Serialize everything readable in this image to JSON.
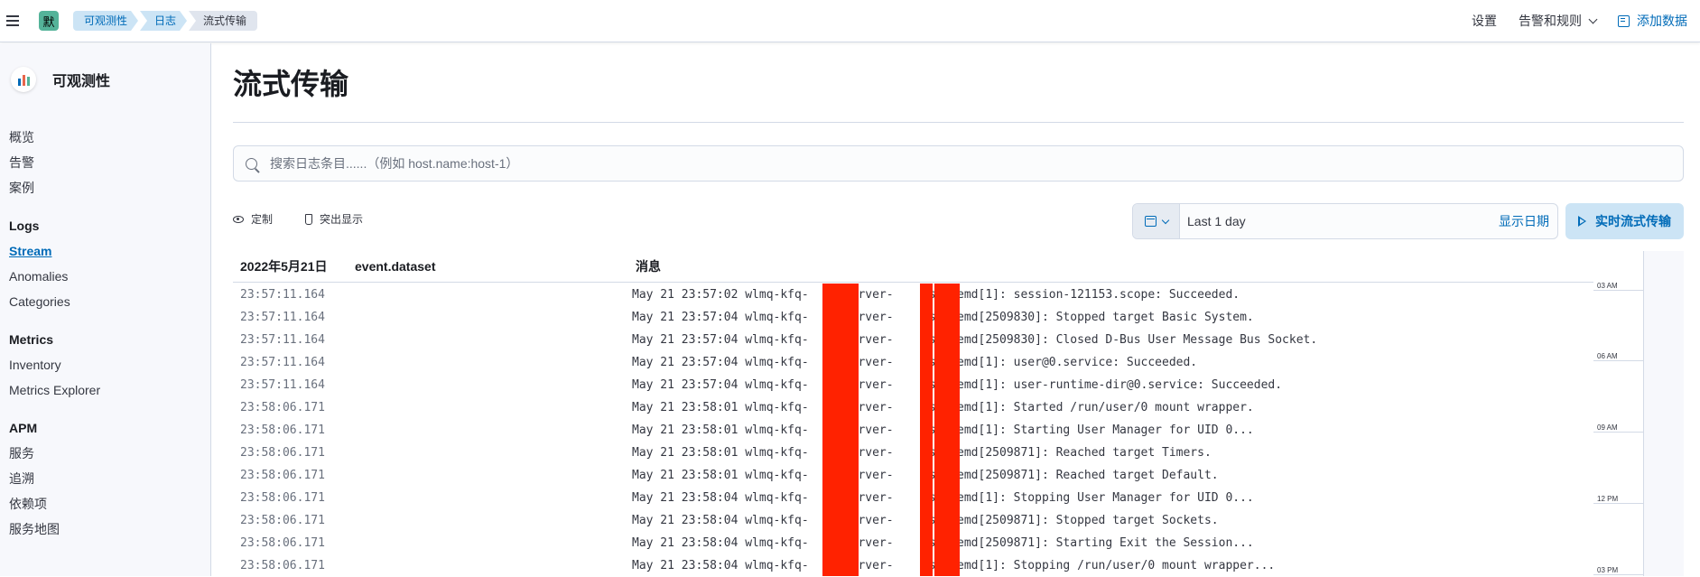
{
  "header": {
    "space_initial": "默",
    "breadcrumbs": [
      "可观测性",
      "日志",
      "流式传输"
    ],
    "settings": "设置",
    "alerts": "告警和规则",
    "add_data": "添加数据"
  },
  "sidebar": {
    "title": "可观测性",
    "top_items": [
      "概览",
      "告警",
      "案例"
    ],
    "groups": [
      {
        "label": "Logs",
        "items": [
          "Stream",
          "Anomalies",
          "Categories"
        ],
        "active": "Stream"
      },
      {
        "label": "Metrics",
        "items": [
          "Inventory",
          "Metrics Explorer"
        ]
      },
      {
        "label": "APM",
        "items": [
          "服务",
          "追溯",
          "依赖项",
          "服务地图"
        ]
      }
    ]
  },
  "main": {
    "title": "流式传输",
    "search_placeholder": "搜索日志条目......（例如 host.name:host-1）",
    "toolbar": {
      "customize": "定制",
      "highlight": "突出显示"
    },
    "date_range": "Last 1 day",
    "show_dates": "显示日期",
    "stream_live": "实时流式传输",
    "columns": {
      "date": "2022年5月21日",
      "dataset": "event.dataset",
      "message": "消息"
    },
    "rows": [
      {
        "time": "23:57:11.164",
        "message": "May 21 23:57:02 wlmq-kfq-    -server-     systemd[1]: session-121153.scope: Succeeded."
      },
      {
        "time": "23:57:11.164",
        "message": "May 21 23:57:04 wlmq-kfq-    -server-     systemd[2509830]: Stopped target Basic System."
      },
      {
        "time": "23:57:11.164",
        "message": "May 21 23:57:04 wlmq-kfq-    -server-     systemd[2509830]: Closed D-Bus User Message Bus Socket."
      },
      {
        "time": "23:57:11.164",
        "message": "May 21 23:57:04 wlmq-kfq-    -server-     systemd[1]: user@0.service: Succeeded."
      },
      {
        "time": "23:57:11.164",
        "message": "May 21 23:57:04 wlmq-kfq-    -server-     systemd[1]: user-runtime-dir@0.service: Succeeded."
      },
      {
        "time": "23:58:06.171",
        "message": "May 21 23:58:01 wlmq-kfq-    -server-     systemd[1]: Started /run/user/0 mount wrapper."
      },
      {
        "time": "23:58:06.171",
        "message": "May 21 23:58:01 wlmq-kfq-    -server-     systemd[1]: Starting User Manager for UID 0..."
      },
      {
        "time": "23:58:06.171",
        "message": "May 21 23:58:01 wlmq-kfq-    -server-     systemd[2509871]: Reached target Timers."
      },
      {
        "time": "23:58:06.171",
        "message": "May 21 23:58:01 wlmq-kfq-    -server-     systemd[2509871]: Reached target Default."
      },
      {
        "time": "23:58:06.171",
        "message": "May 21 23:58:04 wlmq-kfq-    -server-     systemd[1]: Stopping User Manager for UID 0..."
      },
      {
        "time": "23:58:06.171",
        "message": "May 21 23:58:04 wlmq-kfq-    -server-     systemd[2509871]: Stopped target Sockets."
      },
      {
        "time": "23:58:06.171",
        "message": "May 21 23:58:04 wlmq-kfq-    -server-     systemd[2509871]: Starting Exit the Session..."
      },
      {
        "time": "23:58:06.171",
        "message": "May 21 23:58:04 wlmq-kfq-    -server-     systemd[1]: Stopping /run/user/0 mount wrapper..."
      }
    ],
    "minimap_ticks": [
      "03 AM",
      "06 AM",
      "09 AM",
      "12 PM",
      "03 PM"
    ]
  }
}
